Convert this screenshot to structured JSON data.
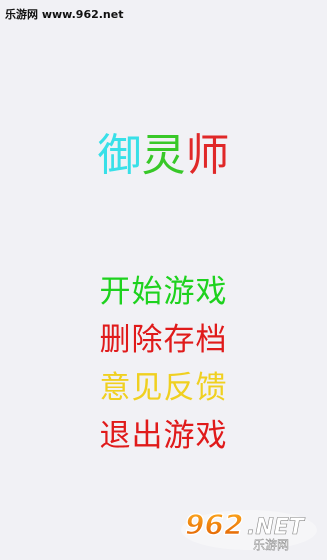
{
  "watermark": {
    "text": "乐游网 www.962.net"
  },
  "title": {
    "chars": [
      "御",
      "灵",
      "师"
    ],
    "colors": [
      "#38e0e8",
      "#38c828",
      "#e02828"
    ]
  },
  "menu": {
    "items": [
      {
        "label": "开始游戏",
        "color": "#1ed21e"
      },
      {
        "label": "删除存档",
        "color": "#e01a1a"
      },
      {
        "label": "意见反馈",
        "color": "#f0d020"
      },
      {
        "label": "退出游戏",
        "color": "#e01a1a"
      }
    ]
  },
  "logo": {
    "text": "962.NET",
    "subtitle": "乐游网"
  }
}
